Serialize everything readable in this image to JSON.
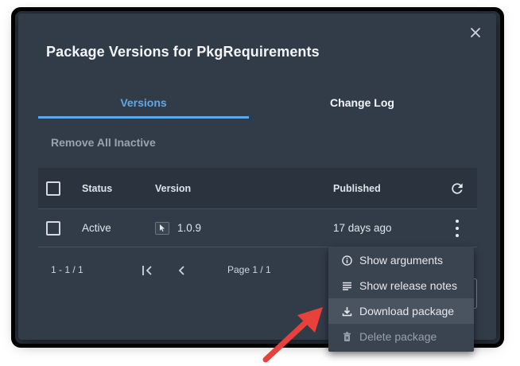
{
  "dialog": {
    "title": "Package Versions for PkgRequirements",
    "close_icon": "close-icon"
  },
  "tabs": [
    {
      "label": "Versions",
      "active": true
    },
    {
      "label": "Change Log",
      "active": false
    }
  ],
  "actions": {
    "remove_all_inactive": "Remove All Inactive"
  },
  "table": {
    "columns": [
      "Status",
      "Version",
      "Published"
    ],
    "rows": [
      {
        "status": "Active",
        "version": "1.0.9",
        "published": "17 days ago"
      }
    ]
  },
  "pagination": {
    "range": "1 - 1 / 1",
    "page_label": "Page 1 / 1"
  },
  "context_menu": {
    "items": [
      {
        "label": "Show arguments",
        "icon": "info-icon"
      },
      {
        "label": "Show release notes",
        "icon": "notes-icon"
      },
      {
        "label": "Download package",
        "icon": "download-icon"
      },
      {
        "label": "Delete package",
        "icon": "trash-icon"
      }
    ]
  },
  "colors": {
    "accent": "#5fa8e8",
    "dialog_bg": "#323c48",
    "menu_bg": "#3a4350",
    "arrow": "#e8403a"
  }
}
